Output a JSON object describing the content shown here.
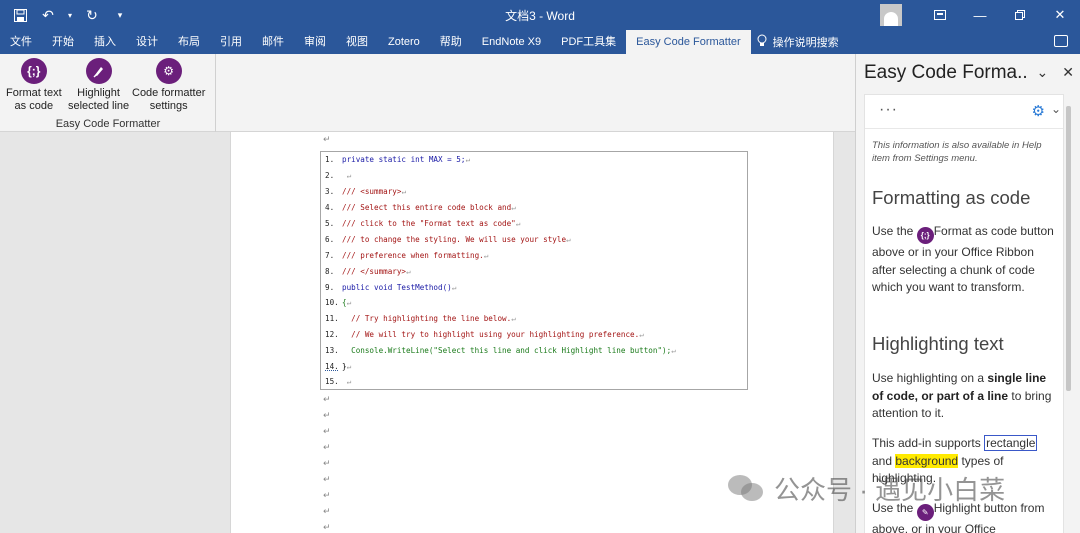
{
  "window": {
    "title": "文档3 - Word"
  },
  "menu_tabs": [
    "文件",
    "开始",
    "插入",
    "设计",
    "布局",
    "引用",
    "邮件",
    "审阅",
    "视图",
    "Zotero",
    "帮助",
    "EndNote X9",
    "PDF工具集",
    "Easy Code Formatter"
  ],
  "active_tab": "Easy Code Formatter",
  "tell_me": "操作说明搜索",
  "ribbon": {
    "format_btn": "Format text\nas code",
    "format_l1": "Format text",
    "format_l2": "as code",
    "highlight_l1": "Highlight",
    "highlight_l2": "selected line",
    "settings_l1": "Code formatter",
    "settings_l2": "settings",
    "group_label": "Easy Code Formatter"
  },
  "code_lines": [
    {
      "n": "1.",
      "text": "private static int MAX = 5;"
    },
    {
      "n": "2.",
      "text": ""
    },
    {
      "n": "3.",
      "text": "/// <summary>"
    },
    {
      "n": "4.",
      "text": "/// Select this entire code block and"
    },
    {
      "n": "5.",
      "text": "/// click to the \"Format text as code\""
    },
    {
      "n": "6.",
      "text": "/// to change the styling. We will use your style"
    },
    {
      "n": "7.",
      "text": "/// preference when formatting."
    },
    {
      "n": "8.",
      "text": "/// </summary>"
    },
    {
      "n": "9.",
      "text": "public void TestMethod()"
    },
    {
      "n": "10.",
      "text": "{"
    },
    {
      "n": "11.",
      "text": "  // Try highlighting the line below."
    },
    {
      "n": "12.",
      "text": "  // We will try to highlight using your highlighting preference."
    },
    {
      "n": "13.",
      "text": "  Console.WriteLine(\"Select this line and click Highlight line button\");"
    },
    {
      "n": "14.",
      "text": "}"
    },
    {
      "n": "15.",
      "text": ""
    }
  ],
  "pane": {
    "title": "Easy Code Forma..",
    "info": "This information is also available in Help item from Settings menu.",
    "h_format": "Formatting as code",
    "p_format_pre": "Use the",
    "p_format_btn": "Format as code",
    "p_format_post": "button above or in your Office Ribbon after selecting a chunk of code which you want to transform.",
    "h_highlight": "Highlighting text",
    "p_hl_1": "Use highlighting on a",
    "p_hl_b1": "single line of code, or part of a line",
    "p_hl_2": "to bring attention to it.",
    "p_sup_1": "This add-in supports",
    "p_sup_rect": "rectangle",
    "p_sup_2": "and",
    "p_sup_bg": "background",
    "p_sup_3": "types of highlighting.",
    "p_use_1": "Use the",
    "p_use_btn": "Highlight",
    "p_use_2": "button",
    "p_use_3": "from above, or in your Office"
  },
  "watermark": "公众号 · 遇见小白菜"
}
